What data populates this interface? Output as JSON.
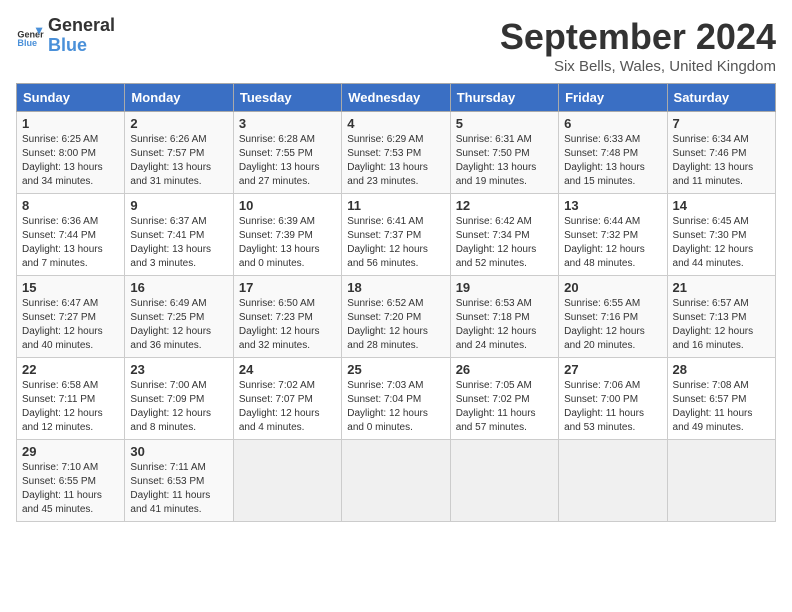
{
  "header": {
    "logo_line1": "General",
    "logo_line2": "Blue",
    "title": "September 2024",
    "location": "Six Bells, Wales, United Kingdom"
  },
  "days_of_week": [
    "Sunday",
    "Monday",
    "Tuesday",
    "Wednesday",
    "Thursday",
    "Friday",
    "Saturday"
  ],
  "weeks": [
    [
      {
        "day": "1",
        "lines": [
          "Sunrise: 6:25 AM",
          "Sunset: 8:00 PM",
          "Daylight: 13 hours",
          "and 34 minutes."
        ]
      },
      {
        "day": "2",
        "lines": [
          "Sunrise: 6:26 AM",
          "Sunset: 7:57 PM",
          "Daylight: 13 hours",
          "and 31 minutes."
        ]
      },
      {
        "day": "3",
        "lines": [
          "Sunrise: 6:28 AM",
          "Sunset: 7:55 PM",
          "Daylight: 13 hours",
          "and 27 minutes."
        ]
      },
      {
        "day": "4",
        "lines": [
          "Sunrise: 6:29 AM",
          "Sunset: 7:53 PM",
          "Daylight: 13 hours",
          "and 23 minutes."
        ]
      },
      {
        "day": "5",
        "lines": [
          "Sunrise: 6:31 AM",
          "Sunset: 7:50 PM",
          "Daylight: 13 hours",
          "and 19 minutes."
        ]
      },
      {
        "day": "6",
        "lines": [
          "Sunrise: 6:33 AM",
          "Sunset: 7:48 PM",
          "Daylight: 13 hours",
          "and 15 minutes."
        ]
      },
      {
        "day": "7",
        "lines": [
          "Sunrise: 6:34 AM",
          "Sunset: 7:46 PM",
          "Daylight: 13 hours",
          "and 11 minutes."
        ]
      }
    ],
    [
      {
        "day": "8",
        "lines": [
          "Sunrise: 6:36 AM",
          "Sunset: 7:44 PM",
          "Daylight: 13 hours",
          "and 7 minutes."
        ]
      },
      {
        "day": "9",
        "lines": [
          "Sunrise: 6:37 AM",
          "Sunset: 7:41 PM",
          "Daylight: 13 hours",
          "and 3 minutes."
        ]
      },
      {
        "day": "10",
        "lines": [
          "Sunrise: 6:39 AM",
          "Sunset: 7:39 PM",
          "Daylight: 13 hours",
          "and 0 minutes."
        ]
      },
      {
        "day": "11",
        "lines": [
          "Sunrise: 6:41 AM",
          "Sunset: 7:37 PM",
          "Daylight: 12 hours",
          "and 56 minutes."
        ]
      },
      {
        "day": "12",
        "lines": [
          "Sunrise: 6:42 AM",
          "Sunset: 7:34 PM",
          "Daylight: 12 hours",
          "and 52 minutes."
        ]
      },
      {
        "day": "13",
        "lines": [
          "Sunrise: 6:44 AM",
          "Sunset: 7:32 PM",
          "Daylight: 12 hours",
          "and 48 minutes."
        ]
      },
      {
        "day": "14",
        "lines": [
          "Sunrise: 6:45 AM",
          "Sunset: 7:30 PM",
          "Daylight: 12 hours",
          "and 44 minutes."
        ]
      }
    ],
    [
      {
        "day": "15",
        "lines": [
          "Sunrise: 6:47 AM",
          "Sunset: 7:27 PM",
          "Daylight: 12 hours",
          "and 40 minutes."
        ]
      },
      {
        "day": "16",
        "lines": [
          "Sunrise: 6:49 AM",
          "Sunset: 7:25 PM",
          "Daylight: 12 hours",
          "and 36 minutes."
        ]
      },
      {
        "day": "17",
        "lines": [
          "Sunrise: 6:50 AM",
          "Sunset: 7:23 PM",
          "Daylight: 12 hours",
          "and 32 minutes."
        ]
      },
      {
        "day": "18",
        "lines": [
          "Sunrise: 6:52 AM",
          "Sunset: 7:20 PM",
          "Daylight: 12 hours",
          "and 28 minutes."
        ]
      },
      {
        "day": "19",
        "lines": [
          "Sunrise: 6:53 AM",
          "Sunset: 7:18 PM",
          "Daylight: 12 hours",
          "and 24 minutes."
        ]
      },
      {
        "day": "20",
        "lines": [
          "Sunrise: 6:55 AM",
          "Sunset: 7:16 PM",
          "Daylight: 12 hours",
          "and 20 minutes."
        ]
      },
      {
        "day": "21",
        "lines": [
          "Sunrise: 6:57 AM",
          "Sunset: 7:13 PM",
          "Daylight: 12 hours",
          "and 16 minutes."
        ]
      }
    ],
    [
      {
        "day": "22",
        "lines": [
          "Sunrise: 6:58 AM",
          "Sunset: 7:11 PM",
          "Daylight: 12 hours",
          "and 12 minutes."
        ]
      },
      {
        "day": "23",
        "lines": [
          "Sunrise: 7:00 AM",
          "Sunset: 7:09 PM",
          "Daylight: 12 hours",
          "and 8 minutes."
        ]
      },
      {
        "day": "24",
        "lines": [
          "Sunrise: 7:02 AM",
          "Sunset: 7:07 PM",
          "Daylight: 12 hours",
          "and 4 minutes."
        ]
      },
      {
        "day": "25",
        "lines": [
          "Sunrise: 7:03 AM",
          "Sunset: 7:04 PM",
          "Daylight: 12 hours",
          "and 0 minutes."
        ]
      },
      {
        "day": "26",
        "lines": [
          "Sunrise: 7:05 AM",
          "Sunset: 7:02 PM",
          "Daylight: 11 hours",
          "and 57 minutes."
        ]
      },
      {
        "day": "27",
        "lines": [
          "Sunrise: 7:06 AM",
          "Sunset: 7:00 PM",
          "Daylight: 11 hours",
          "and 53 minutes."
        ]
      },
      {
        "day": "28",
        "lines": [
          "Sunrise: 7:08 AM",
          "Sunset: 6:57 PM",
          "Daylight: 11 hours",
          "and 49 minutes."
        ]
      }
    ],
    [
      {
        "day": "29",
        "lines": [
          "Sunrise: 7:10 AM",
          "Sunset: 6:55 PM",
          "Daylight: 11 hours",
          "and 45 minutes."
        ]
      },
      {
        "day": "30",
        "lines": [
          "Sunrise: 7:11 AM",
          "Sunset: 6:53 PM",
          "Daylight: 11 hours",
          "and 41 minutes."
        ]
      },
      {
        "day": "",
        "lines": []
      },
      {
        "day": "",
        "lines": []
      },
      {
        "day": "",
        "lines": []
      },
      {
        "day": "",
        "lines": []
      },
      {
        "day": "",
        "lines": []
      }
    ]
  ]
}
